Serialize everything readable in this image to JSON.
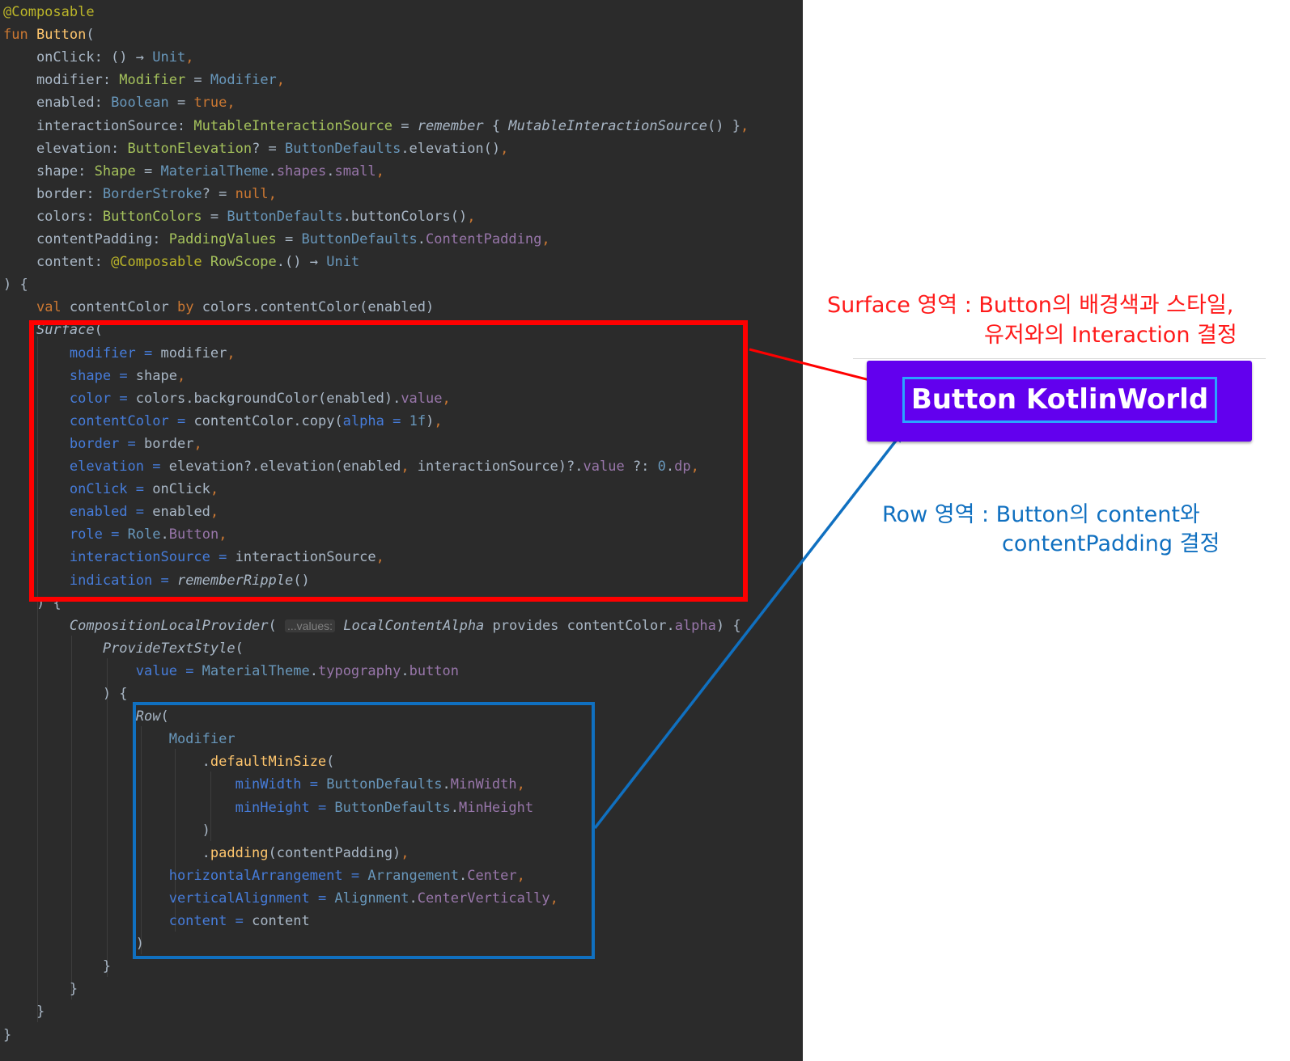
{
  "code_lines": [
    [
      [
        "ann",
        "@Composable"
      ]
    ],
    [
      [
        "k",
        "fun "
      ],
      [
        "fn",
        "Button"
      ],
      [
        "pl",
        "("
      ]
    ],
    [
      [
        "pl",
        "    onClick: () "
      ],
      [
        "pl",
        "→ "
      ],
      [
        "ty",
        "Unit"
      ],
      [
        "k",
        ","
      ]
    ],
    [
      [
        "pl",
        "    modifier: "
      ],
      [
        "ty2",
        "Modifier"
      ],
      [
        "pl",
        " = "
      ],
      [
        "ty",
        "Modifier"
      ],
      [
        "k",
        ","
      ]
    ],
    [
      [
        "pl",
        "    enabled: "
      ],
      [
        "ty",
        "Boolean"
      ],
      [
        "pl",
        " = "
      ],
      [
        "k",
        "true"
      ],
      [
        "k",
        ","
      ]
    ],
    [
      [
        "pl",
        "    interactionSource: "
      ],
      [
        "ty2",
        "MutableInteractionSource"
      ],
      [
        "pl",
        " = "
      ],
      [
        "cmp",
        "remember"
      ],
      [
        "pl",
        " { "
      ],
      [
        "cmp",
        "MutableInteractionSource"
      ],
      [
        "pl",
        "() }"
      ],
      [
        "k",
        ","
      ]
    ],
    [
      [
        "pl",
        "    elevation: "
      ],
      [
        "ty2",
        "ButtonElevation"
      ],
      [
        "pl",
        "? = "
      ],
      [
        "ty",
        "ButtonDefaults"
      ],
      [
        "pl",
        ".elevation()"
      ],
      [
        "k",
        ","
      ]
    ],
    [
      [
        "pl",
        "    shape: "
      ],
      [
        "ty2",
        "Shape"
      ],
      [
        "pl",
        " = "
      ],
      [
        "ty",
        "MaterialTheme"
      ],
      [
        "pl",
        "."
      ],
      [
        "prop",
        "shapes"
      ],
      [
        "pl",
        "."
      ],
      [
        "prop",
        "small"
      ],
      [
        "k",
        ","
      ]
    ],
    [
      [
        "pl",
        "    border: "
      ],
      [
        "ty",
        "BorderStroke"
      ],
      [
        "pl",
        "? = "
      ],
      [
        "k",
        "null"
      ],
      [
        "k",
        ","
      ]
    ],
    [
      [
        "pl",
        "    colors: "
      ],
      [
        "ty2",
        "ButtonColors"
      ],
      [
        "pl",
        " = "
      ],
      [
        "ty",
        "ButtonDefaults"
      ],
      [
        "pl",
        ".buttonColors()"
      ],
      [
        "k",
        ","
      ]
    ],
    [
      [
        "pl",
        "    contentPadding: "
      ],
      [
        "ty2",
        "PaddingValues"
      ],
      [
        "pl",
        " = "
      ],
      [
        "ty",
        "ButtonDefaults"
      ],
      [
        "pl",
        "."
      ],
      [
        "prop",
        "ContentPadding"
      ],
      [
        "k",
        ","
      ]
    ],
    [
      [
        "pl",
        "    content: "
      ],
      [
        "ann",
        "@Composable "
      ],
      [
        "ty2",
        "RowScope"
      ],
      [
        "pl",
        ".() "
      ],
      [
        "pl",
        "→ "
      ],
      [
        "ty",
        "Unit"
      ]
    ],
    [
      [
        "pl",
        ") {"
      ]
    ],
    [
      [
        "pl",
        "    "
      ],
      [
        "k",
        "val "
      ],
      [
        "pl",
        "contentColor "
      ],
      [
        "k",
        "by "
      ],
      [
        "pl",
        "colors.contentColor(enabled)"
      ]
    ],
    [
      [
        "pl",
        "    "
      ],
      [
        "cmp",
        "Surface"
      ],
      [
        "pl",
        "("
      ]
    ],
    [
      [
        "pl",
        "        "
      ],
      [
        "prm",
        "modifier"
      ],
      [
        "prm",
        " = "
      ],
      [
        "pl",
        "modifier"
      ],
      [
        "k",
        ","
      ]
    ],
    [
      [
        "pl",
        "        "
      ],
      [
        "prm",
        "shape"
      ],
      [
        "prm",
        " = "
      ],
      [
        "pl",
        "shape"
      ],
      [
        "k",
        ","
      ]
    ],
    [
      [
        "pl",
        "        "
      ],
      [
        "prm",
        "color"
      ],
      [
        "prm",
        " = "
      ],
      [
        "pl",
        "colors.backgroundColor(enabled)."
      ],
      [
        "prop",
        "value"
      ],
      [
        "k",
        ","
      ]
    ],
    [
      [
        "pl",
        "        "
      ],
      [
        "prm",
        "contentColor"
      ],
      [
        "prm",
        " = "
      ],
      [
        "pl",
        "contentColor.copy("
      ],
      [
        "prm",
        "alpha"
      ],
      [
        "prm",
        " = "
      ],
      [
        "num",
        "1f"
      ],
      [
        "pl",
        ")"
      ],
      [
        "k",
        ","
      ]
    ],
    [
      [
        "pl",
        "        "
      ],
      [
        "prm",
        "border"
      ],
      [
        "prm",
        " = "
      ],
      [
        "pl",
        "border"
      ],
      [
        "k",
        ","
      ]
    ],
    [
      [
        "pl",
        "        "
      ],
      [
        "prm",
        "elevation"
      ],
      [
        "prm",
        " = "
      ],
      [
        "pl",
        "elevation?.elevation(enabled"
      ],
      [
        "k",
        ", "
      ],
      [
        "pl",
        "interactionSource)?."
      ],
      [
        "prop",
        "value"
      ],
      [
        "pl",
        " ?: "
      ],
      [
        "num",
        "0"
      ],
      [
        "pl",
        "."
      ],
      [
        "prop",
        "dp"
      ],
      [
        "k",
        ","
      ]
    ],
    [
      [
        "pl",
        "        "
      ],
      [
        "prm",
        "onClick"
      ],
      [
        "prm",
        " = "
      ],
      [
        "pl",
        "onClick"
      ],
      [
        "k",
        ","
      ]
    ],
    [
      [
        "pl",
        "        "
      ],
      [
        "prm",
        "enabled"
      ],
      [
        "prm",
        " = "
      ],
      [
        "pl",
        "enabled"
      ],
      [
        "k",
        ","
      ]
    ],
    [
      [
        "pl",
        "        "
      ],
      [
        "prm",
        "role"
      ],
      [
        "prm",
        " = "
      ],
      [
        "ty",
        "Role"
      ],
      [
        "pl",
        "."
      ],
      [
        "prop",
        "Button"
      ],
      [
        "k",
        ","
      ]
    ],
    [
      [
        "pl",
        "        "
      ],
      [
        "prm",
        "interactionSource"
      ],
      [
        "prm",
        " = "
      ],
      [
        "pl",
        "interactionSource"
      ],
      [
        "k",
        ","
      ]
    ],
    [
      [
        "pl",
        "        "
      ],
      [
        "prm",
        "indication"
      ],
      [
        "prm",
        " = "
      ],
      [
        "cmp",
        "rememberRipple"
      ],
      [
        "pl",
        "()"
      ]
    ],
    [
      [
        "pl",
        "    ) {"
      ]
    ],
    [
      [
        "pl",
        "        "
      ],
      [
        "cmp",
        "CompositionLocalProvider"
      ],
      [
        "pl",
        "( "
      ],
      [
        "hint",
        "...values:"
      ],
      [
        "pl",
        " "
      ],
      [
        "cmp",
        "LocalContentAlpha"
      ],
      [
        "pl",
        " provides contentColor."
      ],
      [
        "prop",
        "alpha"
      ],
      [
        "pl",
        ") {"
      ]
    ],
    [
      [
        "pl",
        "            "
      ],
      [
        "cmp",
        "ProvideTextStyle"
      ],
      [
        "pl",
        "("
      ]
    ],
    [
      [
        "pl",
        "                "
      ],
      [
        "prm",
        "value"
      ],
      [
        "prm",
        " = "
      ],
      [
        "ty",
        "MaterialTheme"
      ],
      [
        "pl",
        "."
      ],
      [
        "prop",
        "typography"
      ],
      [
        "pl",
        "."
      ],
      [
        "prop",
        "button"
      ]
    ],
    [
      [
        "pl",
        "            ) {"
      ]
    ],
    [
      [
        "pl",
        "                "
      ],
      [
        "cmp",
        "Row"
      ],
      [
        "pl",
        "("
      ]
    ],
    [
      [
        "pl",
        "                    "
      ],
      [
        "ty",
        "Modifier"
      ]
    ],
    [
      [
        "pl",
        "                        ."
      ],
      [
        "fn",
        "defaultMinSize"
      ],
      [
        "pl",
        "("
      ]
    ],
    [
      [
        "pl",
        "                            "
      ],
      [
        "prm",
        "minWidth"
      ],
      [
        "prm",
        " = "
      ],
      [
        "ty",
        "ButtonDefaults"
      ],
      [
        "pl",
        "."
      ],
      [
        "prop",
        "MinWidth"
      ],
      [
        "k",
        ","
      ]
    ],
    [
      [
        "pl",
        "                            "
      ],
      [
        "prm",
        "minHeight"
      ],
      [
        "prm",
        " = "
      ],
      [
        "ty",
        "ButtonDefaults"
      ],
      [
        "pl",
        "."
      ],
      [
        "prop",
        "MinHeight"
      ]
    ],
    [
      [
        "pl",
        "                        )"
      ]
    ],
    [
      [
        "pl",
        "                        ."
      ],
      [
        "fn",
        "padding"
      ],
      [
        "pl",
        "(contentPadding)"
      ],
      [
        "k",
        ","
      ]
    ],
    [
      [
        "pl",
        "                    "
      ],
      [
        "prm",
        "horizontalArrangement"
      ],
      [
        "prm",
        " = "
      ],
      [
        "ty",
        "Arrangement"
      ],
      [
        "pl",
        "."
      ],
      [
        "prop",
        "Center"
      ],
      [
        "k",
        ","
      ]
    ],
    [
      [
        "pl",
        "                    "
      ],
      [
        "prm",
        "verticalAlignment"
      ],
      [
        "prm",
        " = "
      ],
      [
        "ty",
        "Alignment"
      ],
      [
        "pl",
        "."
      ],
      [
        "prop",
        "CenterVertically"
      ],
      [
        "k",
        ","
      ]
    ],
    [
      [
        "pl",
        "                    "
      ],
      [
        "prm",
        "content"
      ],
      [
        "prm",
        " = "
      ],
      [
        "pl",
        "content"
      ]
    ],
    [
      [
        "pl",
        "                )"
      ]
    ],
    [
      [
        "pl",
        "            }"
      ]
    ],
    [
      [
        "pl",
        "        }"
      ]
    ],
    [
      [
        "pl",
        "    }"
      ]
    ],
    [
      [
        "pl",
        "}"
      ]
    ]
  ],
  "annotations": {
    "surface_line1": "Surface 영역 : Button의 배경색과 스타일,",
    "surface_line2": "유저와의 Interaction 결정",
    "row_line1": "Row 영역 : Button의 content와",
    "row_line2": "contentPadding 결정"
  },
  "preview": {
    "button_text": "Button KotlinWorld"
  },
  "colors": {
    "editor_background": "#2b2b2b",
    "surface_highlight": "#ff0000",
    "row_highlight": "#1070c0",
    "preview_button": "#6200ee",
    "preview_text_outline": "#2aa3ff"
  }
}
